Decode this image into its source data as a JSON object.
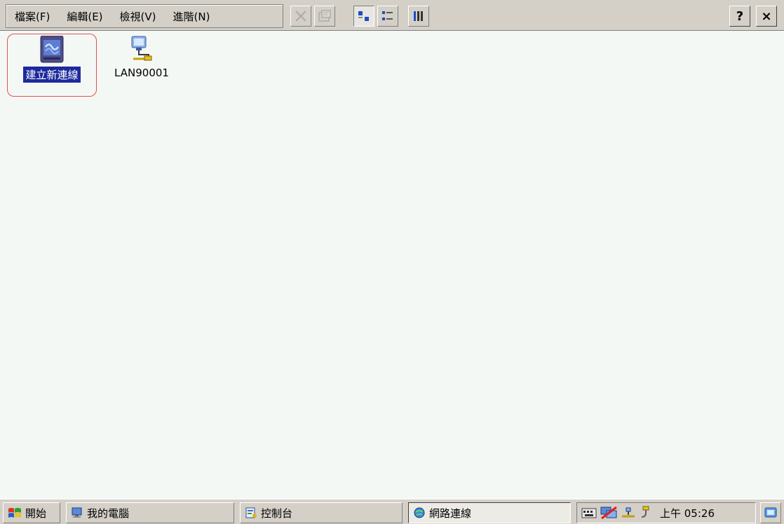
{
  "menubar": {
    "menus": [
      "檔案(F)",
      "編輯(E)",
      "檢視(V)",
      "進階(N)"
    ],
    "toolbar": {
      "delete_icon": "delete-x-icon",
      "properties_icon": "properties-icon",
      "large_icons_icon": "large-icons-view-icon",
      "small_icons_icon": "small-icons-view-icon",
      "details_icon": "details-view-icon"
    },
    "help_label": "?",
    "close_label": "×"
  },
  "desktop": {
    "items": [
      {
        "label": "建立新連線",
        "icon": "make-new-connection-icon",
        "selected": true
      },
      {
        "label": "LAN90001",
        "icon": "lan-connection-icon",
        "selected": false
      }
    ]
  },
  "taskbar": {
    "start_label": "開始",
    "buttons": [
      {
        "label": "我的電腦",
        "icon": "my-computer-icon"
      },
      {
        "label": "控制台",
        "icon": "control-panel-icon"
      },
      {
        "label": "網路連線",
        "icon": "network-connections-icon",
        "active": true
      }
    ],
    "clock": "上午 05:26"
  },
  "colors": {
    "background": "#f4f8f4",
    "chrome": "#d4d0c8",
    "selection": "#1c2a9c",
    "highlight_ring": "#e05050"
  }
}
